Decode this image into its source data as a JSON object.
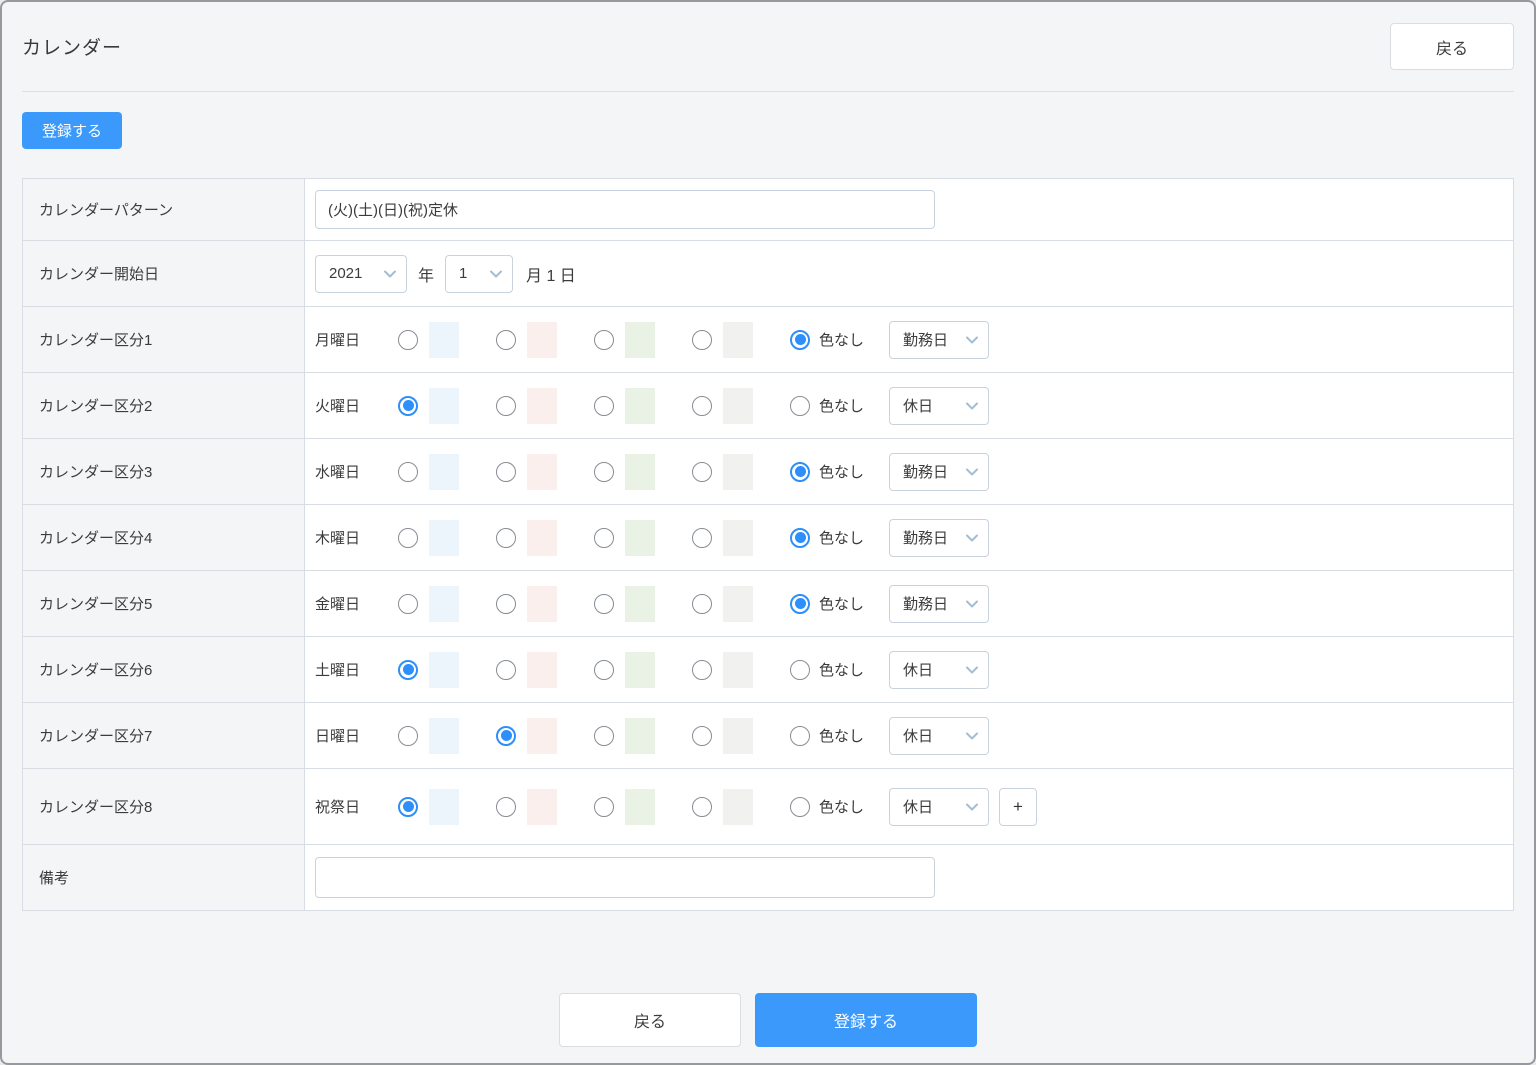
{
  "header": {
    "title": "カレンダー",
    "back_button": "戻る"
  },
  "toolbar": {
    "register_button": "登録する"
  },
  "form": {
    "pattern": {
      "label": "カレンダーパターン",
      "value": "(火)(土)(日)(祝)定休"
    },
    "start_date": {
      "label": "カレンダー開始日",
      "year": "2021",
      "year_unit": "年",
      "month": "1",
      "month_unit": "月 1 日"
    },
    "no_color_label": "色なし",
    "add_button_label": "+",
    "swatch_colors": [
      "#ecf5fb",
      "#fbefee",
      "#e9f2e5",
      "#f1f1ef"
    ],
    "divisions": [
      {
        "label": "カレンダー区分1",
        "day": "月曜日",
        "selected": 4,
        "type": "勤務日",
        "has_add": false
      },
      {
        "label": "カレンダー区分2",
        "day": "火曜日",
        "selected": 0,
        "type": "休日",
        "has_add": false
      },
      {
        "label": "カレンダー区分3",
        "day": "水曜日",
        "selected": 4,
        "type": "勤務日",
        "has_add": false
      },
      {
        "label": "カレンダー区分4",
        "day": "木曜日",
        "selected": 4,
        "type": "勤務日",
        "has_add": false
      },
      {
        "label": "カレンダー区分5",
        "day": "金曜日",
        "selected": 4,
        "type": "勤務日",
        "has_add": false
      },
      {
        "label": "カレンダー区分6",
        "day": "土曜日",
        "selected": 0,
        "type": "休日",
        "has_add": false
      },
      {
        "label": "カレンダー区分7",
        "day": "日曜日",
        "selected": 1,
        "type": "休日",
        "has_add": false
      },
      {
        "label": "カレンダー区分8",
        "day": "祝祭日",
        "selected": 0,
        "type": "休日",
        "has_add": true
      }
    ],
    "remarks": {
      "label": "備考",
      "value": ""
    }
  },
  "footer": {
    "back_button": "戻る",
    "register_button": "登録する"
  },
  "colors": {
    "accent": "#3b99fc",
    "radio_selected": "#2e8efa",
    "table_border": "#d8dde3",
    "label_cell_bg": "#f4f5f6"
  }
}
